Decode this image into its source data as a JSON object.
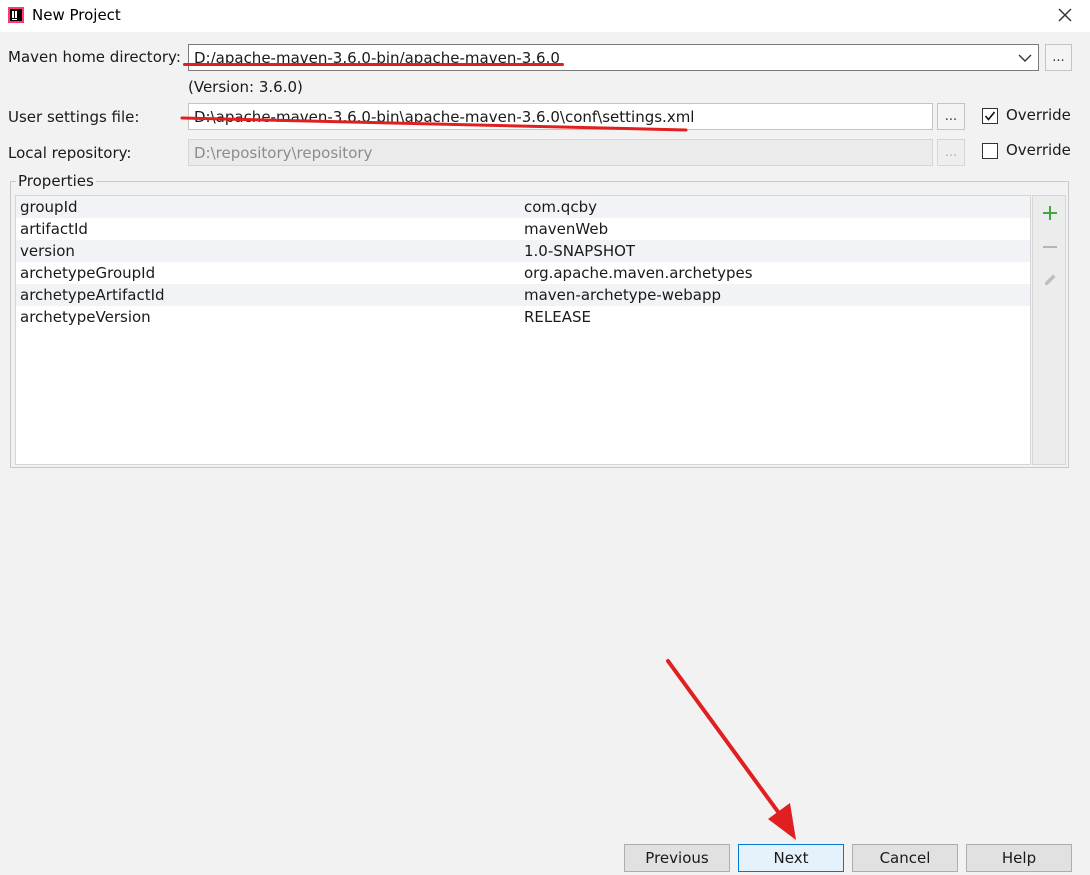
{
  "window": {
    "title": "New Project"
  },
  "maven_home": {
    "label": "Maven home directory:",
    "value": "D:/apache-maven-3.6.0-bin/apache-maven-3.6.0",
    "version": "(Version: 3.6.0)",
    "browse_label": "..."
  },
  "user_settings": {
    "label": "User settings file:",
    "value": "D:\\apache-maven-3.6.0-bin\\apache-maven-3.6.0\\conf\\settings.xml",
    "browse_label": "...",
    "override_label": "Override",
    "override_checked": true
  },
  "local_repo": {
    "label": "Local repository:",
    "value": "D:\\repository\\repository",
    "browse_label": "...",
    "override_label": "Override",
    "override_checked": false
  },
  "properties": {
    "title": "Properties",
    "rows": [
      {
        "key": "groupId",
        "value": "com.qcby"
      },
      {
        "key": "artifactId",
        "value": "mavenWeb"
      },
      {
        "key": "version",
        "value": "1.0-SNAPSHOT"
      },
      {
        "key": "archetypeGroupId",
        "value": "org.apache.maven.archetypes"
      },
      {
        "key": "archetypeArtifactId",
        "value": "maven-archetype-webapp"
      },
      {
        "key": "archetypeVersion",
        "value": "RELEASE"
      }
    ]
  },
  "footer": {
    "previous": "Previous",
    "next": "Next",
    "cancel": "Cancel",
    "help": "Help"
  },
  "colors": {
    "annotation_red": "#e02020",
    "add_green": "#3ea83e",
    "primary_border": "#0078d7"
  }
}
